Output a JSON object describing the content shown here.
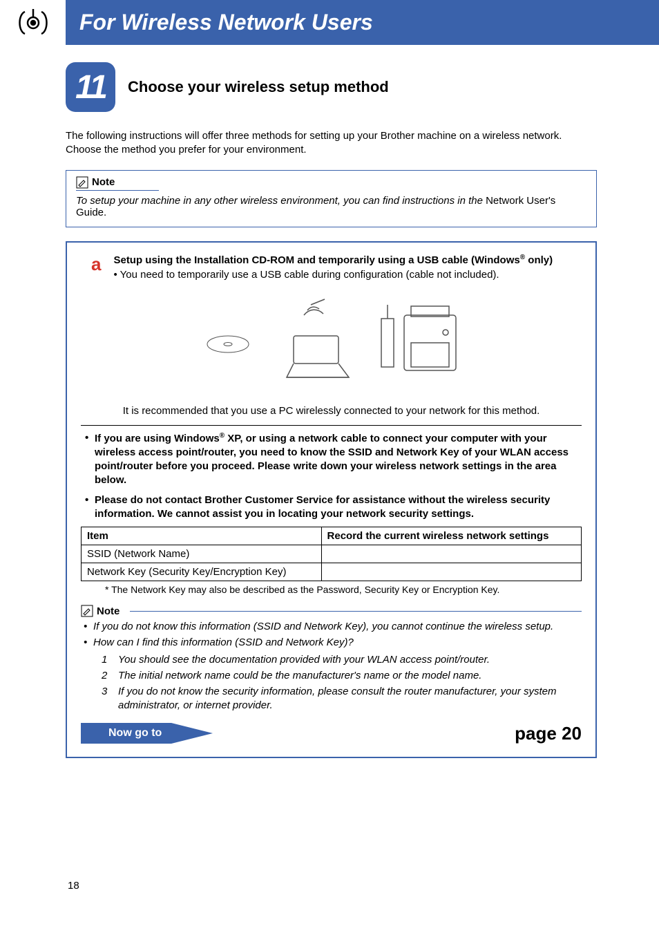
{
  "header": {
    "title": "For Wireless Network Users",
    "icon_name": "wireless-signal-icon"
  },
  "step": {
    "number": "11",
    "title": "Choose your wireless setup method"
  },
  "intro": "The following instructions will offer three methods for setting up your Brother machine on a wireless network. Choose the method you prefer for your environment.",
  "top_note": {
    "label": "Note",
    "text_italic": "To setup your machine in any other wireless environment, you can find instructions in the ",
    "text_plain": "Network User's Guide",
    "text_after": "."
  },
  "option_a": {
    "letter": "a",
    "title_pre": "Setup using the Installation CD-ROM and temporarily using a USB cable (Windows",
    "title_sup": "®",
    "title_post": " only)",
    "sub": "You need to temporarily use a USB cable during configuration (cable not included).",
    "recommend": "It is recommended that you use a PC wirelessly connected to your network for this method.",
    "warn1_pre": "If you are using Windows",
    "warn1_sup": "®",
    "warn1_post": " XP, or using a network cable to connect your computer with your wireless access point/router, you need to know the SSID and Network Key of your WLAN access point/router before you proceed. Please write down your wireless network settings in the area below.",
    "warn2": "Please do not contact Brother Customer Service for assistance without the wireless security information. We cannot assist you in locating your network security settings.",
    "table": {
      "h1": "Item",
      "h2": "Record the current wireless network settings",
      "r1": "SSID (Network Name)",
      "r2": "Network Key (Security Key/Encryption Key)"
    },
    "footnote": "*  The Network Key may also be described as the Password, Security Key or Encryption Key.",
    "inner_note": {
      "label": "Note",
      "li1": "If you do not know this information (SSID and Network Key), you cannot continue the wireless setup.",
      "li2": "How can I find this information (SSID and Network Key)?",
      "ol1": "You should see the documentation provided with your WLAN access point/router.",
      "ol2": "The initial network name could be the manufacturer's name or the model name.",
      "ol3": "If you do not know the security information, please consult the router manufacturer, your system administrator, or internet provider."
    },
    "goto_label": "Now go to",
    "goto_page": "page 20"
  },
  "page_number": "18"
}
